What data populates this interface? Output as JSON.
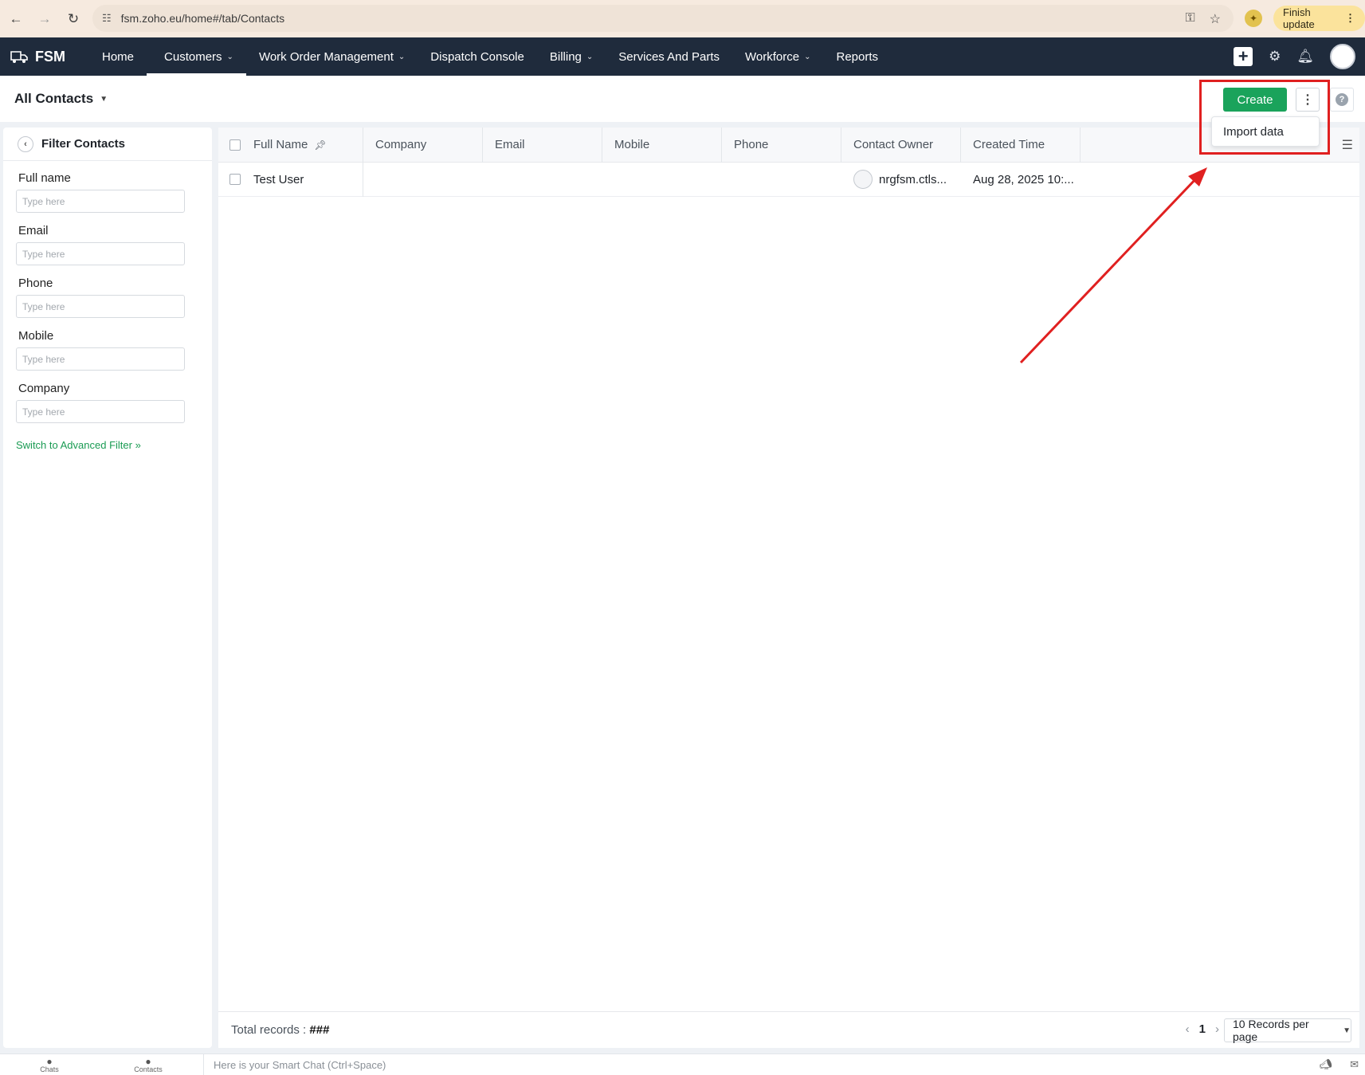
{
  "browser": {
    "url": "fsm.zoho.eu/home#/tab/Contacts",
    "finish_update": "Finish update",
    "back_icon": "arrow-left-icon",
    "forward_icon": "arrow-right-icon",
    "reload_icon": "reload-icon"
  },
  "app": {
    "logo": "FSM",
    "nav": [
      {
        "label": "Home"
      },
      {
        "label": "Customers",
        "dropdown": true,
        "active": true
      },
      {
        "label": "Work Order Management",
        "dropdown": true
      },
      {
        "label": "Dispatch Console"
      },
      {
        "label": "Billing",
        "dropdown": true
      },
      {
        "label": "Services And Parts"
      },
      {
        "label": "Workforce",
        "dropdown": true
      },
      {
        "label": "Reports"
      }
    ]
  },
  "subheader": {
    "view_title": "All Contacts",
    "create_label": "Create",
    "menu_item": "Import data"
  },
  "filter": {
    "title": "Filter Contacts",
    "fields": [
      {
        "label": "Full name",
        "placeholder": "Type here"
      },
      {
        "label": "Email",
        "placeholder": "Type here"
      },
      {
        "label": "Phone",
        "placeholder": "Type here"
      },
      {
        "label": "Mobile",
        "placeholder": "Type here"
      },
      {
        "label": "Company",
        "placeholder": "Type here"
      }
    ],
    "advanced_link": "Switch to Advanced Filter"
  },
  "table": {
    "columns": [
      "Full Name",
      "Company",
      "Email",
      "Mobile",
      "Phone",
      "Contact Owner",
      "Created Time"
    ],
    "rows": [
      {
        "full_name": "Test User",
        "company": "",
        "email": "",
        "mobile": "",
        "phone": "",
        "owner": "nrgfsm.ctls...",
        "created": "Aug 28, 2025 10:..."
      }
    ]
  },
  "footer": {
    "total_label": "Total records :",
    "total_value": "###",
    "page": "1",
    "per_page": "10 Records per page"
  },
  "bottom_bar": {
    "chats": "Chats",
    "contacts": "Contacts",
    "smart_chat": "Here is your Smart Chat (Ctrl+Space)"
  },
  "colors": {
    "header_bg": "#1f2b3c",
    "create_green": "#1aa35b",
    "annotation_red": "#e02020"
  }
}
